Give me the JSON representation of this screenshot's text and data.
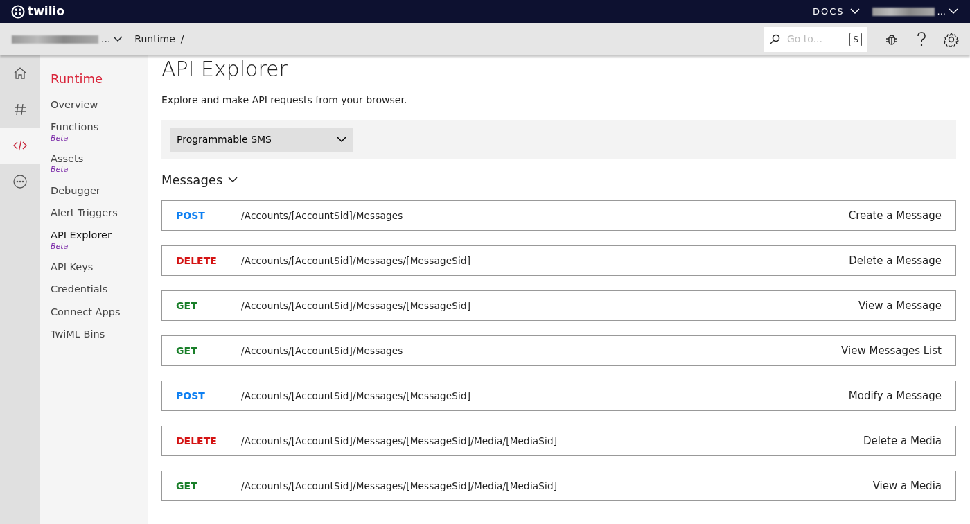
{
  "topbar": {
    "logo": "twilio",
    "docs": "DOCS",
    "account_ellipsis": "..."
  },
  "subbar": {
    "project_ellipsis": "...",
    "breadcrumb": "Runtime",
    "separator": "/",
    "search": {
      "placeholder": "Go to...",
      "shortcut": "S"
    }
  },
  "rail": [
    {
      "kind": "home",
      "selected": false
    },
    {
      "kind": "hash",
      "selected": false
    },
    {
      "kind": "code",
      "selected": true
    },
    {
      "kind": "more",
      "selected": false
    }
  ],
  "sidebar": {
    "title": "Runtime",
    "items": [
      {
        "label": "Overview",
        "selected": false
      },
      {
        "label": "Functions",
        "badge": "Beta",
        "selected": false
      },
      {
        "label": "Assets",
        "badge": "Beta",
        "selected": false
      },
      {
        "label": "Debugger",
        "selected": false
      },
      {
        "label": "Alert Triggers",
        "selected": false
      },
      {
        "label": "API Explorer",
        "badge": "Beta",
        "selected": true
      },
      {
        "label": "API Keys",
        "selected": false
      },
      {
        "label": "Credentials",
        "selected": false
      },
      {
        "label": "Connect Apps",
        "selected": false
      },
      {
        "label": "TwiML Bins",
        "selected": false
      }
    ]
  },
  "page": {
    "title": "API Explorer",
    "description": "Explore and make API requests from your browser.",
    "product_select": "Programmable SMS",
    "section": "Messages",
    "endpoints": [
      {
        "kind": "post",
        "method": "POST",
        "path": "/Accounts/[AccountSid]/Messages",
        "action": "Create a Message"
      },
      {
        "kind": "delete",
        "method": "DELETE",
        "path": "/Accounts/[AccountSid]/Messages/[MessageSid]",
        "action": "Delete a Message"
      },
      {
        "kind": "get",
        "method": "GET",
        "path": "/Accounts/[AccountSid]/Messages/[MessageSid]",
        "action": "View a Message"
      },
      {
        "kind": "get",
        "method": "GET",
        "path": "/Accounts/[AccountSid]/Messages",
        "action": "View Messages List"
      },
      {
        "kind": "post",
        "method": "POST",
        "path": "/Accounts/[AccountSid]/Messages/[MessageSid]",
        "action": "Modify a Message"
      },
      {
        "kind": "delete",
        "method": "DELETE",
        "path": "/Accounts/[AccountSid]/Messages/[MessageSid]/Media/[MediaSid]",
        "action": "Delete a Media"
      },
      {
        "kind": "get",
        "method": "GET",
        "path": "/Accounts/[AccountSid]/Messages/[MessageSid]/Media/[MediaSid]",
        "action": "View a Media"
      }
    ]
  }
}
